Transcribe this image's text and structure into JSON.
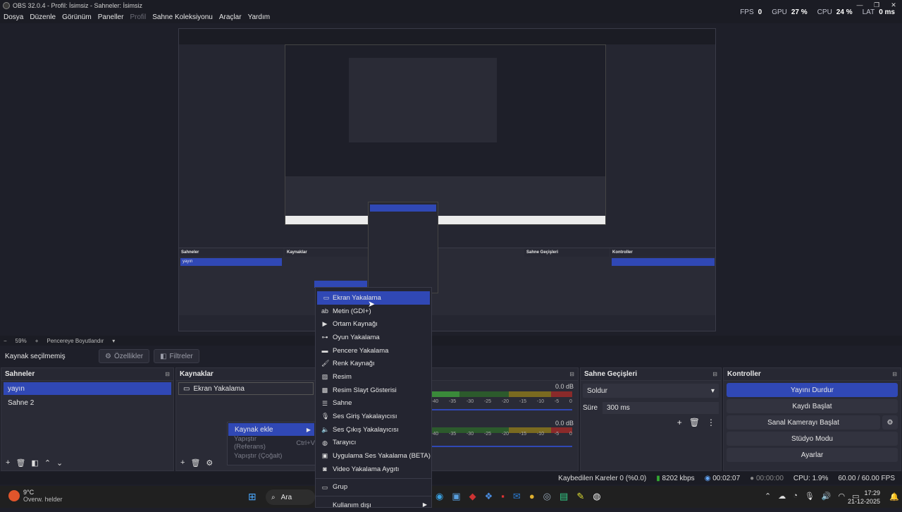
{
  "window": {
    "title": "OBS 32.0.4 - Profil: İsimsiz - Sahneler: İsimsiz"
  },
  "menu": [
    "Dosya",
    "Düzenle",
    "Görünüm",
    "Paneller",
    "Profil",
    "Sahne Koleksiyonu",
    "Araçlar",
    "Yardım"
  ],
  "stats": {
    "fps_label": "FPS",
    "fps": "0",
    "gpu_label": "GPU",
    "gpu": "27 %",
    "cpu_label": "CPU",
    "cpu": "24 %",
    "lat_label": "LAT",
    "lat": "0 ms"
  },
  "zoom": {
    "value": "59%",
    "mode": "Pencereye Boyutlandır"
  },
  "source_bar": {
    "label": "Kaynak seçilmemiş",
    "properties": "Özellikler",
    "filters": "Filtreler"
  },
  "scenes": {
    "title": "Sahneler",
    "items": [
      "yayın",
      "Sahne 2"
    ]
  },
  "sources": {
    "title": "Kaynaklar",
    "items": [
      "Ekran Yakalama"
    ]
  },
  "transitions": {
    "title": "Sahne Geçişleri",
    "type": "Soldur",
    "duration_label": "Süre",
    "duration": "300 ms"
  },
  "controls": {
    "title": "Kontroller",
    "buttons": [
      "Yayını Durdur",
      "Kaydı Başlat",
      "Sanal Kamerayı Başlat",
      "Stüdyo Modu",
      "Ayarlar"
    ]
  },
  "mixer": {
    "db1": "0.0 dB",
    "db2": "0.0 dB",
    "ticks": [
      "-40",
      "-35",
      "-30",
      "-25",
      "-20",
      "-15",
      "-10",
      "-5",
      "0"
    ]
  },
  "context_menu": {
    "items": [
      "Ekran Yakalama",
      "Metin (GDI+)",
      "Ortam Kaynağı",
      "Oyun Yakalama",
      "Pencere Yakalama",
      "Renk Kaynağı",
      "Resim",
      "Resim Slayt Gösterisi",
      "Sahne",
      "Ses Giriş Yakalayıcısı",
      "Ses Çıkış Yakalayıcısı",
      "Tarayıcı",
      "Uygulama Ses Yakalama (BETA)",
      "Video Yakalama Aygıtı"
    ],
    "group": "Grup",
    "deprecated": "Kullanım dışı"
  },
  "sub_menu": {
    "add": "Kaynak ekle",
    "paste_ref": "Yapıştır (Referans)",
    "paste_ref_shortcut": "Ctrl+V",
    "paste_dup": "Yapıştır (Çoğalt)"
  },
  "status": {
    "dropped": "Kaybedilen Kareler 0 (%0.0)",
    "bitrate": "8202 kbps",
    "stream_time": "00:02:07",
    "rec_time": "00:00:00",
    "cpu": "CPU: 1.9%",
    "fps": "60.00 / 60.00 FPS"
  },
  "taskbar": {
    "weather_temp": "9°C",
    "weather_desc": "Overw. helder",
    "search": "Ara",
    "time": "17:29",
    "date": "21-12-2025"
  },
  "colors": {
    "accent": "#3048b5",
    "panel": "#2a2b36",
    "bg": "#1e1f29"
  }
}
